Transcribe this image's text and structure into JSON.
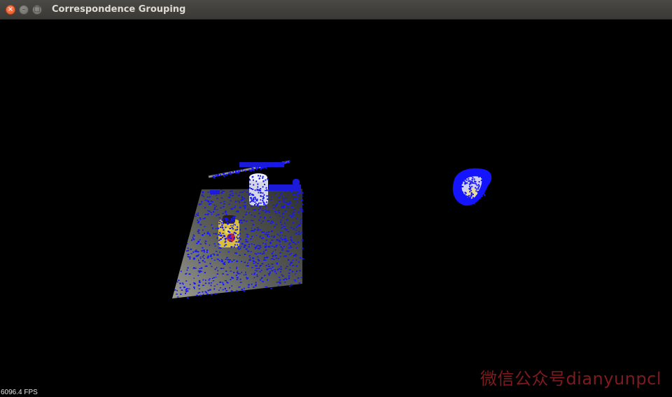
{
  "window": {
    "title": "Correspondence Grouping",
    "close_glyph": "×",
    "minimize_glyph": "–",
    "maximize_glyph": "□"
  },
  "viewer": {
    "fps_text": "6096.4 FPS",
    "background_color": "#000000",
    "scene_keypoint_color": "#1414ff",
    "model_keypoint_color": "#1414ff"
  },
  "watermark": {
    "text": "微信公众号dianyunpcl",
    "color": "#7e1b1e"
  }
}
